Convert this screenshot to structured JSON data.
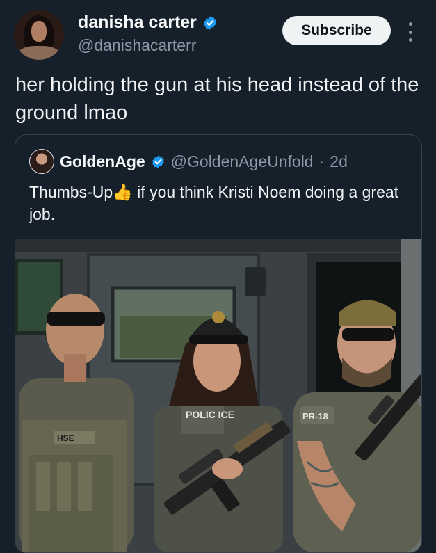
{
  "author": {
    "display_name": "danisha carter",
    "handle": "@danishacarterr",
    "avatar_icon": "profile-photo",
    "verified_color": "#1d9bf0"
  },
  "actions": {
    "subscribe_label": "Subscribe",
    "more_icon": "more-vertical-icon"
  },
  "tweet": {
    "text": "her holding the gun at his head instead of the ground lmao"
  },
  "quoted": {
    "display_name": "GoldenAge",
    "handle": "@GoldenAgeUnfold",
    "separator": "·",
    "time": "2d",
    "text_before_emoji": "Thumbs-Up",
    "emoji": "👍",
    "text_after_emoji": " if you think Kristi Noem doing a great job.",
    "media": {
      "description_icon": "photo",
      "vest_label_center": "POLIC ICE",
      "vest_label_left": "HSE",
      "patch_right": "PR-18"
    }
  },
  "colors": {
    "background": "#15202b",
    "text_primary": "#f1f3f5",
    "text_secondary": "#8b98a5",
    "verified": "#1d9bf0",
    "border": "#38444d"
  }
}
